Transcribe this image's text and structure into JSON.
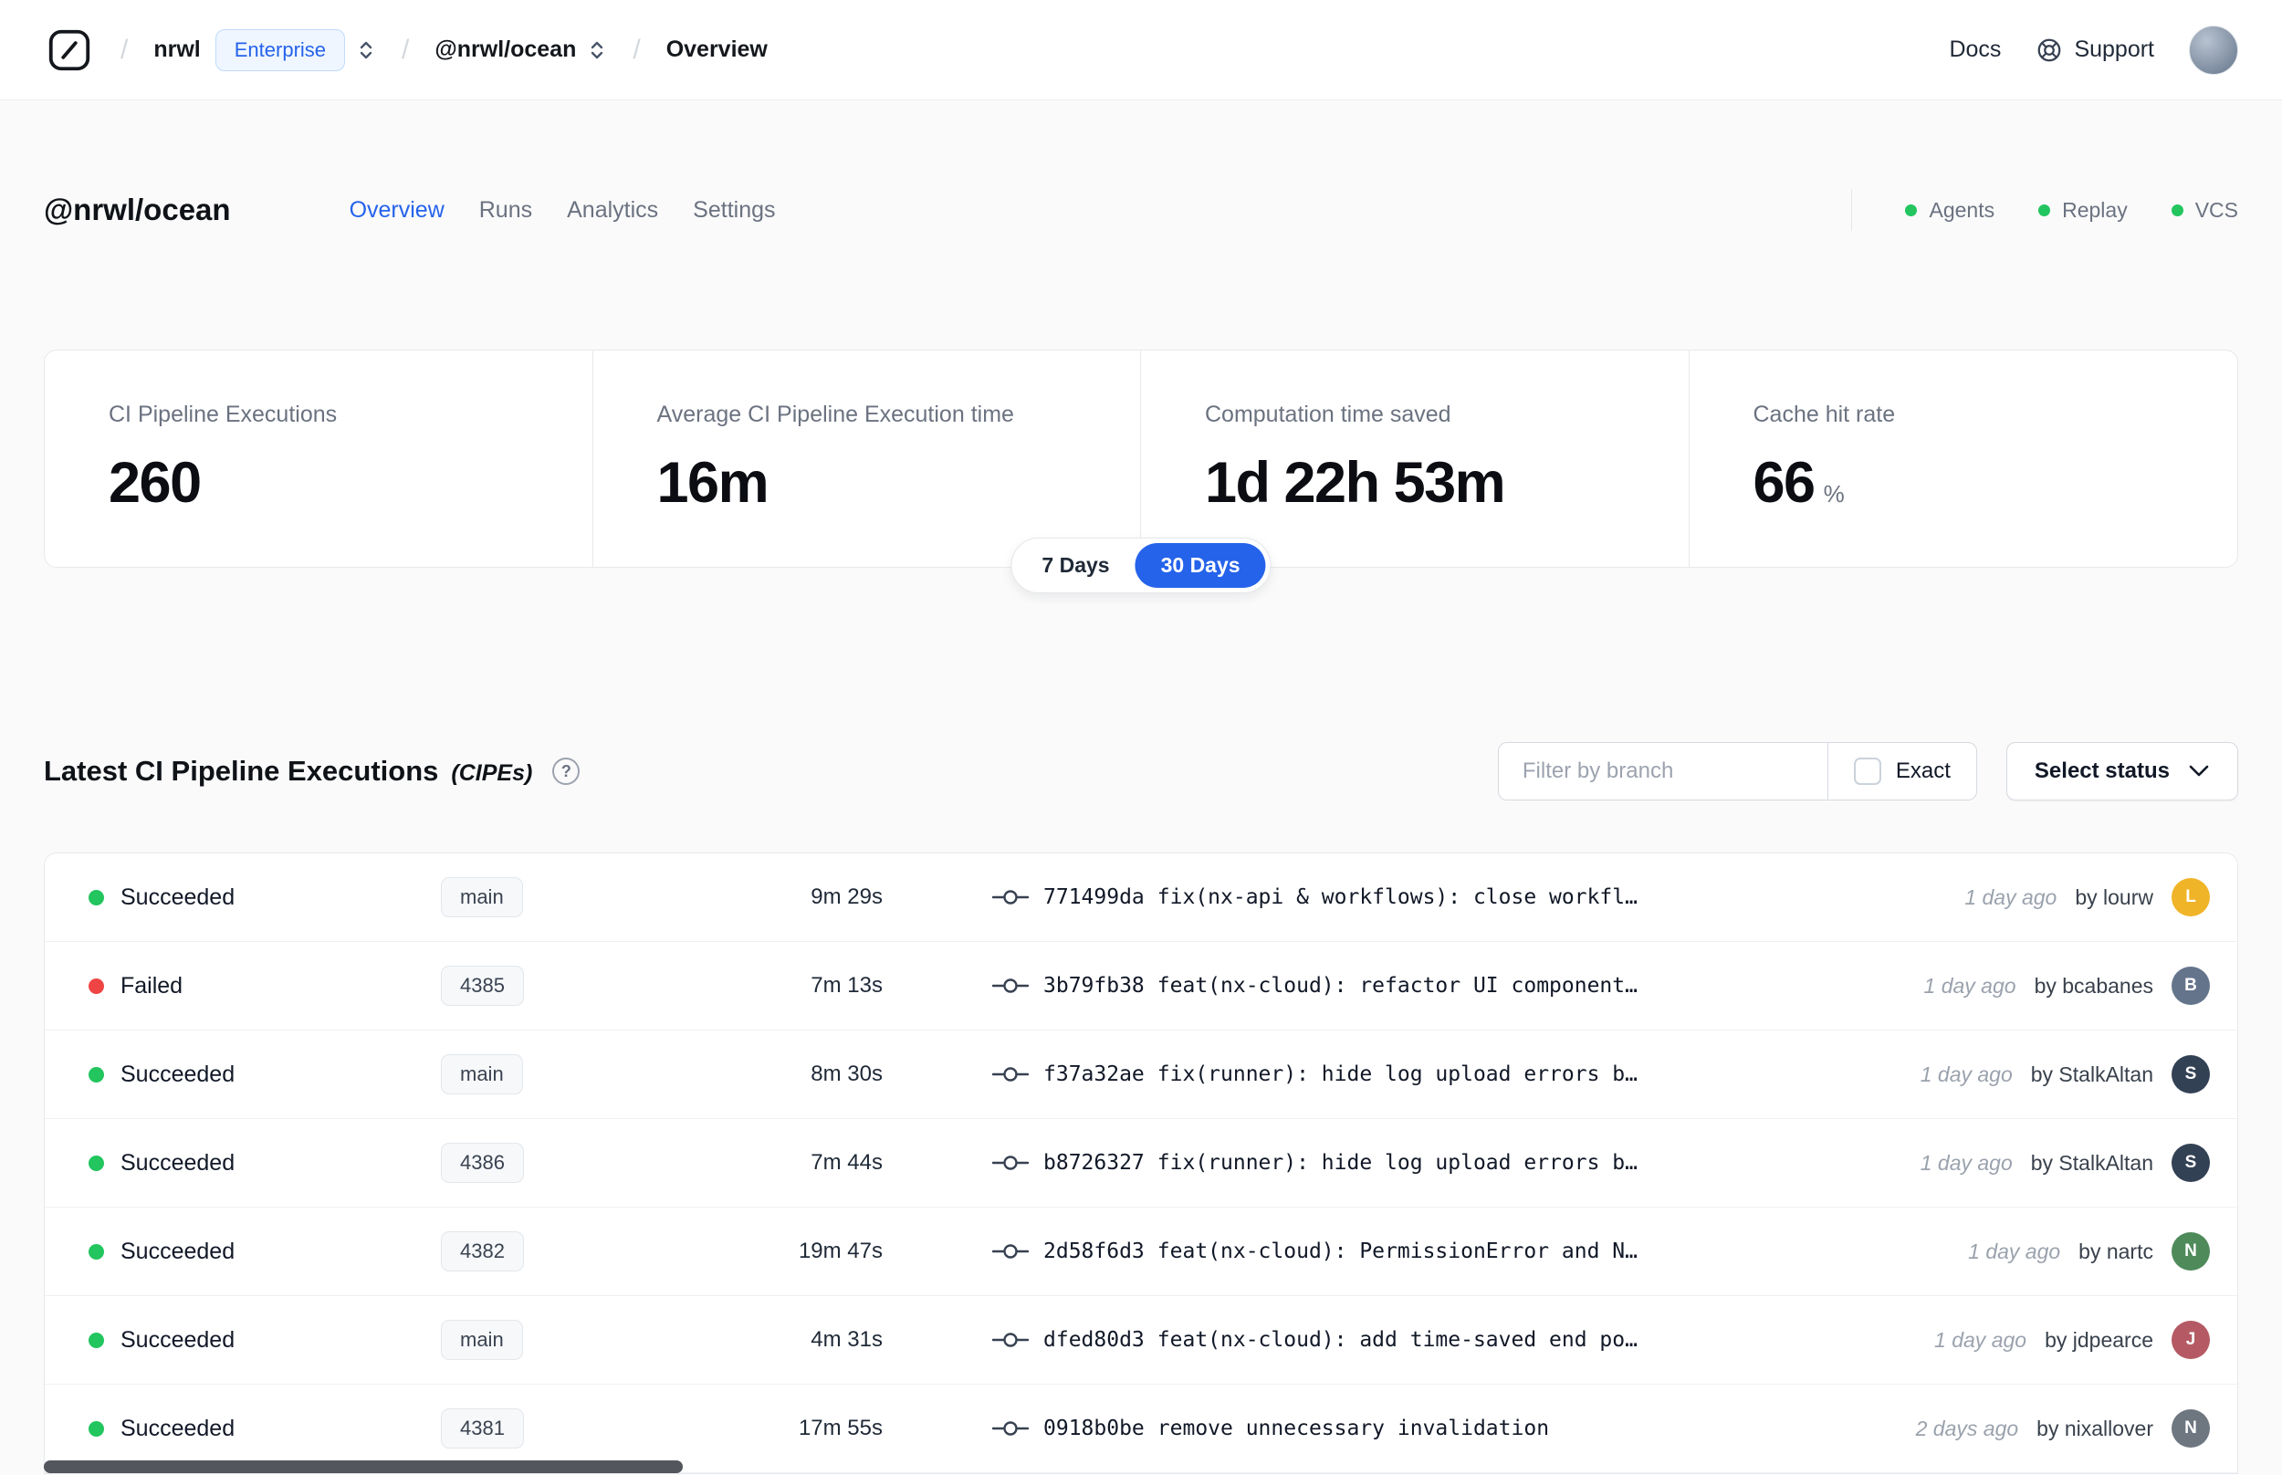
{
  "navbar": {
    "separator": "/",
    "org": {
      "name": "nrwl",
      "badge": "Enterprise"
    },
    "workspace": "@nrwl/ocean",
    "page": "Overview",
    "docs": "Docs",
    "support": "Support"
  },
  "header": {
    "title": "@nrwl/ocean",
    "tabs": [
      {
        "label": "Overview"
      },
      {
        "label": "Runs"
      },
      {
        "label": "Analytics"
      },
      {
        "label": "Settings"
      }
    ],
    "statuses": [
      {
        "label": "Agents"
      },
      {
        "label": "Replay"
      },
      {
        "label": "VCS"
      }
    ],
    "status_dot_color": "#22c55e"
  },
  "stats": {
    "cards": [
      {
        "label": "CI Pipeline Executions",
        "value": "260"
      },
      {
        "label": "Average CI Pipeline Execution time",
        "value": "16m"
      },
      {
        "label": "Computation time saved",
        "value": "1d 22h 53m"
      },
      {
        "label": "Cache hit rate",
        "value": "66",
        "unit": "%"
      }
    ],
    "range_toggle": [
      {
        "label": "7 Days",
        "active": false
      },
      {
        "label": "30 Days",
        "active": true
      }
    ]
  },
  "cipes": {
    "title": "Latest CI Pipeline Executions",
    "suffix": "(CIPEs)",
    "help": "?",
    "filter_placeholder": "Filter by branch",
    "exact": "Exact",
    "select_status": "Select status",
    "rows": [
      {
        "status": "Succeeded",
        "dot_color": "#22c55e",
        "branch": "main",
        "duration": "9m 29s",
        "commit_hash": "771499da",
        "commit_message": "fix(nx-api & workflows): close workfl…",
        "time": "1 day ago",
        "author": "by lourw",
        "avatar_initial": "L",
        "avatar_color": "#f0b429"
      },
      {
        "status": "Failed",
        "dot_color": "#ef4444",
        "branch": "4385",
        "duration": "7m 13s",
        "commit_hash": "3b79fb38",
        "commit_message": "feat(nx-cloud): refactor UI component…",
        "time": "1 day ago",
        "author": "by bcabanes",
        "avatar_initial": "B",
        "avatar_color": "#64748b"
      },
      {
        "status": "Succeeded",
        "dot_color": "#22c55e",
        "branch": "main",
        "duration": "8m 30s",
        "commit_hash": "f37a32ae",
        "commit_message": "fix(runner): hide log upload errors b…",
        "time": "1 day ago",
        "author": "by StalkAltan",
        "avatar_initial": "S",
        "avatar_color": "#334155"
      },
      {
        "status": "Succeeded",
        "dot_color": "#22c55e",
        "branch": "4386",
        "duration": "7m 44s",
        "commit_hash": "b8726327",
        "commit_message": "fix(runner): hide log upload errors b…",
        "time": "1 day ago",
        "author": "by StalkAltan",
        "avatar_initial": "S",
        "avatar_color": "#334155"
      },
      {
        "status": "Succeeded",
        "dot_color": "#22c55e",
        "branch": "4382",
        "duration": "19m 47s",
        "commit_hash": "2d58f6d3",
        "commit_message": "feat(nx-cloud): PermissionError and N…",
        "time": "1 day ago",
        "author": "by nartc",
        "avatar_initial": "N",
        "avatar_color": "#4e8a5a"
      },
      {
        "status": "Succeeded",
        "dot_color": "#22c55e",
        "branch": "main",
        "duration": "4m 31s",
        "commit_hash": "dfed80d3",
        "commit_message": "feat(nx-cloud): add time-saved end po…",
        "time": "1 day ago",
        "author": "by jdpearce",
        "avatar_initial": "J",
        "avatar_color": "#b55a64"
      },
      {
        "status": "Succeeded",
        "dot_color": "#22c55e",
        "branch": "4381",
        "duration": "17m 55s",
        "commit_hash": "0918b0be",
        "commit_message": "remove unnecessary invalidation",
        "time": "2 days ago",
        "author": "by nixallover",
        "avatar_initial": "N",
        "avatar_color": "#6e7680"
      }
    ]
  },
  "colors": {
    "accent": "#2563eb",
    "succeeded": "#22c55e",
    "failed": "#ef4444"
  }
}
